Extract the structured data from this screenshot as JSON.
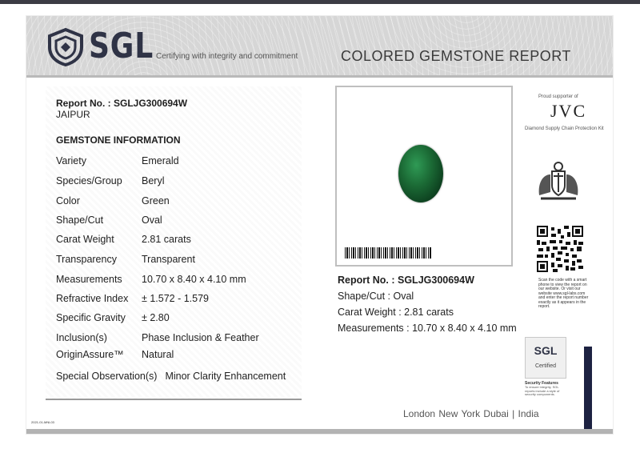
{
  "header": {
    "logo_text": "SGL",
    "tagline": "Certifying with integrity and commitment",
    "title": "COLORED GEMSTONE REPORT"
  },
  "report": {
    "number_line": "Report No. : SGLJG300694W",
    "city": "JAIPUR",
    "section_title": "GEMSTONE INFORMATION",
    "rows": [
      {
        "label": "Variety",
        "value": "Emerald"
      },
      {
        "label": "Species/Group",
        "value": "Beryl"
      },
      {
        "label": "Color",
        "value": "Green"
      },
      {
        "label": "Shape/Cut",
        "value": "Oval"
      },
      {
        "label": "Carat Weight",
        "value": "2.81 carats"
      },
      {
        "label": "Transparency",
        "value": "Transparent"
      },
      {
        "label": "Measurements",
        "value": "10.70 x 8.40 x 4.10 mm"
      },
      {
        "label": "Refractive Index",
        "value": "± 1.572 - 1.579"
      },
      {
        "label": "Specific Gravity",
        "value": "± 2.80"
      },
      {
        "label": "Inclusion(s)",
        "value": "Phase Inclusion & Feather"
      },
      {
        "label": "OriginAssure™",
        "value": "Natural"
      },
      {
        "label": "Special Observation(s)",
        "value": "Minor Clarity Enhancement"
      }
    ]
  },
  "summary": {
    "number_line": "Report No. : SGLJG300694W",
    "shape": "Shape/Cut : Oval",
    "carat": "Carat Weight : 2.81 carats",
    "measurements": "Measurements : 10.70 x 8.40 x 4.10 mm"
  },
  "side": {
    "jvc_small": "Proud supporter of",
    "jvc": "JVC",
    "jvc_sub": "Diamond Supply Chain Protection Kit",
    "qr_text": "Scan the code with a smart phone to view the report on our website. Or visit our website www.sgl-labs.com and enter the report number exactly as it appears in the report.",
    "badge_logo": "SGL",
    "badge_cert": "Certified",
    "security_title": "Security Features",
    "security_text": "To ensure integrity, SGL reports include a style of security components."
  },
  "footer": {
    "cities": "London  New York  Dubai  |  India",
    "code": "2021-01-MNL03"
  },
  "colors": {
    "brand_navy": "#2f3346",
    "gem_green": "#1b6a35",
    "navy_bar": "#1d2242"
  }
}
